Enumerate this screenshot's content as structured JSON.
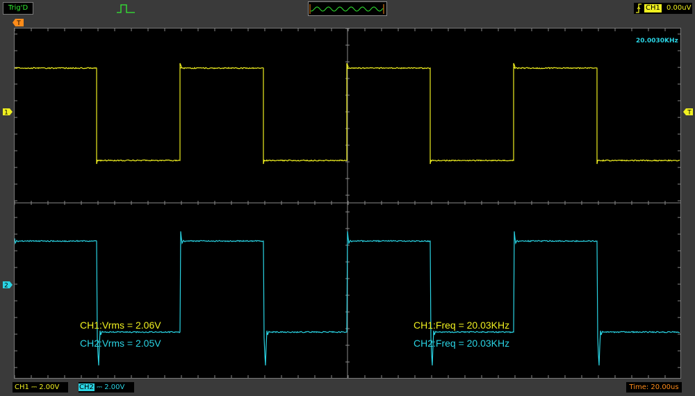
{
  "top": {
    "trig_status": "Trig'D",
    "trigger_channel": "CH1",
    "trigger_level": "0.00uV",
    "trigger_marker": "T",
    "icons": {
      "pulse": "pulse-icon",
      "edge": "rising-edge-icon"
    }
  },
  "channels": {
    "ch1": {
      "marker": "1",
      "color": "#f0f020"
    },
    "ch2": {
      "marker": "2",
      "color": "#2ad4e4"
    }
  },
  "screen": {
    "freq_readout": "20.0030KHz",
    "measurements": [
      {
        "text": "CH1:Vrms = 2.06V",
        "color": "#f0f020"
      },
      {
        "text": "CH2:Vrms = 2.05V",
        "color": "#2ad4e4"
      },
      {
        "text": "CH1:Freq = 20.03KHz",
        "color": "#f0f020"
      },
      {
        "text": "CH2:Freq = 20.03KHz",
        "color": "#2ad4e4"
      }
    ]
  },
  "bottom": {
    "ch1_tag": "CH1",
    "ch1_scale": "2.00V",
    "ch2_tag": "CH2",
    "ch2_scale": "2.00V",
    "time_scale": "Time: 20.00us"
  }
}
